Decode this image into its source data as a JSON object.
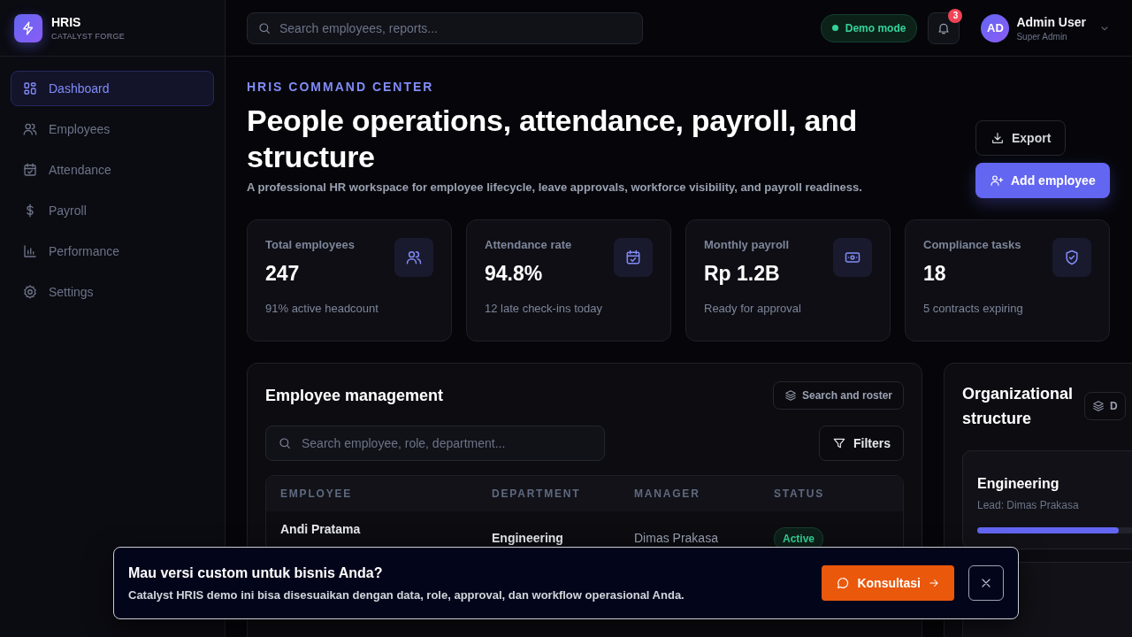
{
  "brand": {
    "name": "HRIS",
    "subtitle": "CATALYST FORGE"
  },
  "sidebar": {
    "items": [
      {
        "label": "Dashboard",
        "selected": true
      },
      {
        "label": "Employees",
        "selected": false
      },
      {
        "label": "Attendance",
        "selected": false
      },
      {
        "label": "Payroll",
        "selected": false
      },
      {
        "label": "Performance",
        "selected": false
      },
      {
        "label": "Settings",
        "selected": false
      }
    ]
  },
  "topbar": {
    "search": {
      "placeholder": "Search employees, reports..."
    },
    "mode": "Demo mode",
    "notifications": "3",
    "user": {
      "initials": "AD",
      "name": "Admin User",
      "role": "Super Admin"
    }
  },
  "hero": {
    "eyebrow": "HRIS COMMAND CENTER",
    "title": "People operations, attendance, payroll, and structure",
    "subtitle": "A professional HR workspace for employee lifecycle, leave approvals, workforce visibility, and payroll readiness.",
    "buttons": [
      {
        "label": "Export",
        "kind": "secondary"
      },
      {
        "label": "Add employee",
        "kind": "primary"
      }
    ]
  },
  "stats": [
    {
      "label": "Total employees",
      "value": "247",
      "note": "91% active headcount"
    },
    {
      "label": "Attendance rate",
      "value": "94.8%",
      "note": "12 late check-ins today"
    },
    {
      "label": "Monthly payroll",
      "value": "Rp 1.2B",
      "note": "Ready for approval"
    },
    {
      "label": "Compliance tasks",
      "value": "18",
      "note": "5 contracts expiring"
    }
  ],
  "employees": {
    "title": "Employee management",
    "tag": "Search and roster",
    "search": {
      "placeholder": "Search employee, role, department..."
    },
    "filter": "Filters",
    "columns": [
      "EMPLOYEE",
      "DEPARTMENT",
      "MANAGER",
      "STATUS"
    ],
    "rows": [
      {
        "name": "Andi Pratama",
        "department": "Engineering",
        "manager": "Dimas Prakasa",
        "status": "Active"
      }
    ]
  },
  "org": {
    "title": "Organizational structure",
    "tag": "D",
    "units": [
      {
        "name": "Engineering",
        "lead": "Lead: Dimas Prakasa",
        "level": 0.91
      }
    ]
  },
  "banner": {
    "title": "Mau versi custom untuk bisnis Anda?",
    "text": "Catalyst HRIS demo ini bisa disesuaikan dengan data, role, approval, dan workflow operasional Anda.",
    "action": "Konsultasi"
  }
}
